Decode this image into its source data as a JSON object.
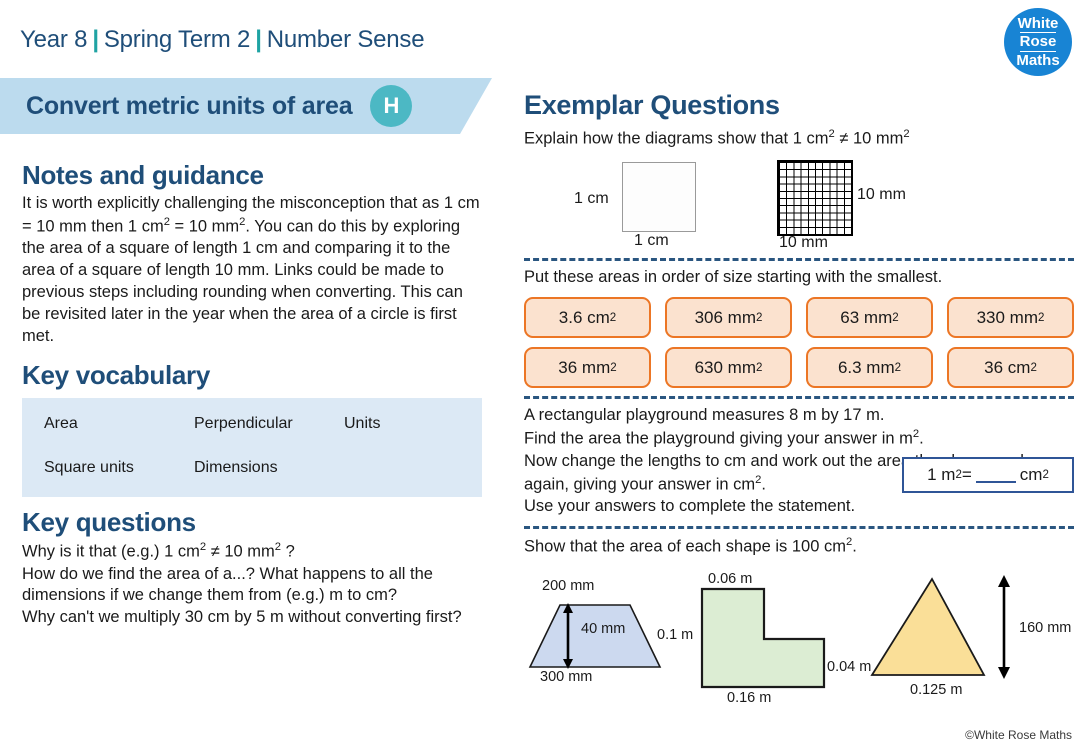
{
  "header": {
    "year": "Year 8",
    "term": "Spring Term 2",
    "strand": "Number Sense",
    "separator": "|",
    "logo": {
      "line1": "White",
      "line2": "Rose",
      "line3": "Maths"
    },
    "title": "Convert metric units of area",
    "tier_badge": "H"
  },
  "left": {
    "notes_heading": "Notes and guidance",
    "notes_body_parts": {
      "p1": "It is worth explicitly challenging the misconception that as 1 cm = 10 mm then 1 cm",
      "sup1": "2",
      "p2": " = 10 mm",
      "sup2": "2",
      "p3": ".  You can do this by exploring the area of a square of length 1 cm and comparing it to the area of a square of length 10 mm. Links could be made to previous steps including rounding when converting. This can be revisited later in the year when the area of a circle is first met."
    },
    "vocab_heading": "Key vocabulary",
    "vocabulary": [
      [
        "Area",
        "Perpendicular",
        "Units"
      ],
      [
        "Square units",
        "Dimensions",
        ""
      ]
    ],
    "questions_heading": "Key questions",
    "key_questions": {
      "q1_a": "Why is it that (e.g.) 1 cm",
      "q1_sup1": "2",
      "q1_b": " ≠ 10 mm",
      "q1_sup2": "2",
      "q1_c": " ?",
      "q2": "How do we find the area of a...?  What happens to all the dimensions if we change them from (e.g.) m to cm?",
      "q3": "Why can't we multiply 30 cm by 5 m without converting first?"
    }
  },
  "right": {
    "heading": "Exemplar Questions",
    "q1": {
      "prompt_a": "Explain how the diagrams show that 1 cm",
      "prompt_sup1": "2",
      "prompt_b": " ≠ 10 mm",
      "prompt_sup2": "2",
      "square_left_label": "1 cm",
      "square_bottom_label": "1 cm",
      "grid_right_label": "10 mm",
      "grid_bottom_label": "10 mm",
      "grid_divisions": 10
    },
    "q2": {
      "prompt": "Put these areas in order of size starting with the smallest.",
      "cards": [
        {
          "value": "3.6 cm",
          "exp": "2"
        },
        {
          "value": "306 mm",
          "exp": "2"
        },
        {
          "value": "63 mm",
          "exp": "2"
        },
        {
          "value": "330 mm",
          "exp": "2"
        },
        {
          "value": "36 mm",
          "exp": "2"
        },
        {
          "value": "630 mm",
          "exp": "2"
        },
        {
          "value": "6.3 mm",
          "exp": "2"
        },
        {
          "value": "36 cm",
          "exp": "2"
        }
      ]
    },
    "q3": {
      "line1": "A rectangular playground measures 8 m by 17 m.",
      "line2_a": "Find the area the playground giving your answer in m",
      "line2_sup": "2",
      "line2_b": ".",
      "line3": "Now change the lengths to cm and work out the area the playground",
      "line4_a": "again, giving your answer in cm",
      "line4_sup": "2",
      "line4_b": ".",
      "line5": "Use your answers to complete the statement.",
      "answer_box": {
        "left_a": "1 m",
        "left_sup": "2",
        "left_b": " =",
        "right_a": "cm",
        "right_sup": "2"
      }
    },
    "q4": {
      "prompt_a": "Show that the area of each shape is 100 cm",
      "prompt_sup": "2",
      "prompt_b": ".",
      "shapes": [
        {
          "name": "trapezium",
          "fill": "#ccd9ef",
          "labels": {
            "top": "200 mm",
            "height": "40 mm",
            "bottom": "300 mm"
          }
        },
        {
          "name": "l-shape",
          "fill": "#dcedd3",
          "labels": {
            "top": "0.06 m",
            "left": "0.1 m",
            "right": "0.04 m",
            "bottom": "0.16 m"
          }
        },
        {
          "name": "triangle",
          "fill": "#fadf98",
          "labels": {
            "height": "160 mm",
            "base": "0.125 m"
          }
        }
      ]
    }
  },
  "footer": {
    "copyright": "©White Rose Maths"
  },
  "colors": {
    "brand_blue": "#1f4e79",
    "banner_blue": "#bcdbee",
    "badge_teal": "#4cb8c4",
    "vocab_blue": "#dce9f5",
    "card_border_orange": "#ec7625",
    "card_fill_orange": "#fbe2cf",
    "answer_border_blue": "#2f5597",
    "logo_blue": "#1884d4",
    "sep_teal": "#1fa3a3"
  }
}
